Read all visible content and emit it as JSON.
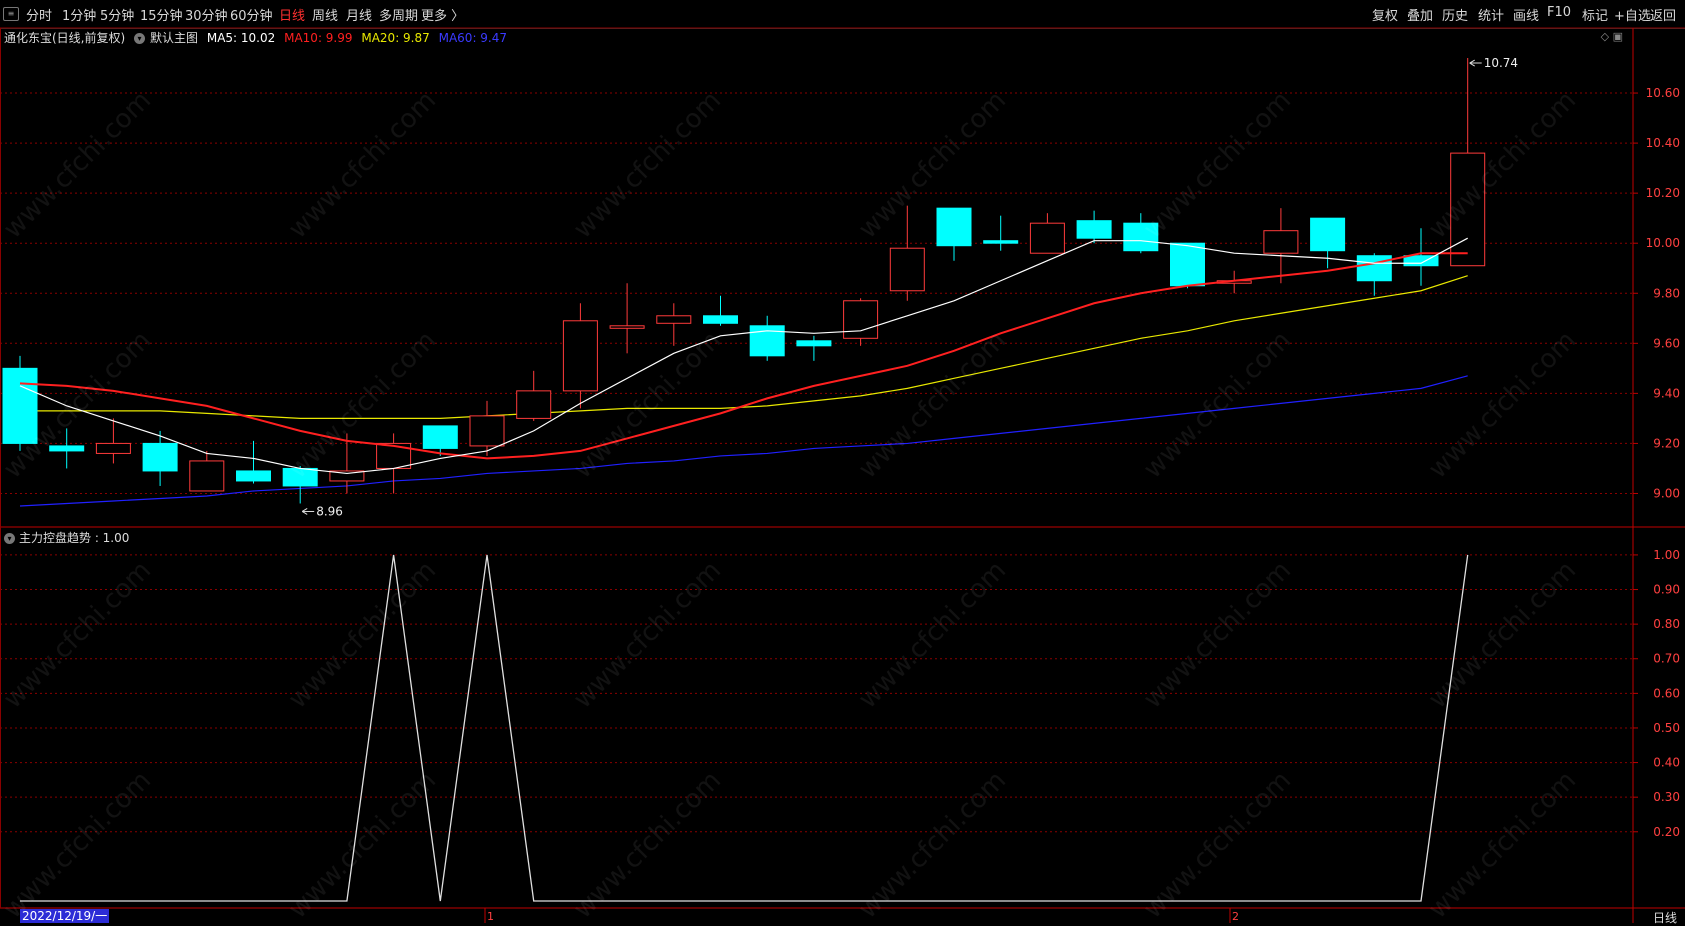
{
  "toolbar": {
    "periods": [
      "分时",
      "1分钟",
      "5分钟",
      "15分钟",
      "30分钟",
      "60分钟",
      "日线",
      "周线",
      "月线",
      "多周期",
      "更多 〉"
    ],
    "active_period": "日线",
    "right_items": [
      "复权",
      "叠加",
      "历史",
      "统计",
      "画线",
      "F10",
      "标记",
      "+自选",
      "返回"
    ]
  },
  "info": {
    "stock": "通化东宝(日线,前复权)",
    "main_label": "默认主图",
    "ma5": "MA5: 10.02",
    "ma10": "MA10: 9.99",
    "ma20": "MA20: 9.87",
    "ma60": "MA60: 9.47"
  },
  "sub_indicator": "主力控盘趋势 : 1.00",
  "bottom": {
    "date": "2022/12/19/一",
    "period": "日线",
    "markers": [
      "1",
      "2"
    ]
  },
  "watermark": "www.cfchi.com",
  "colors": {
    "up": "#ff3b3b",
    "down": "#00ffff",
    "ma5": "#ffffff",
    "ma10": "#ff2020",
    "ma20": "#e8e800",
    "ma60": "#2020ff",
    "grid": "#8a0000",
    "active": "#ff3030"
  },
  "chart_data": [
    {
      "type": "candlestick",
      "title": "通化东宝(日线,前复权)",
      "yticks": [
        "9.00",
        "9.20",
        "9.40",
        "9.60",
        "9.80",
        "10.00",
        "10.20",
        "10.40",
        "10.60"
      ],
      "ylim": [
        8.87,
        10.78
      ],
      "candles": [
        {
          "o": 9.5,
          "h": 9.55,
          "l": 9.17,
          "c": 9.2
        },
        {
          "o": 9.19,
          "h": 9.26,
          "l": 9.1,
          "c": 9.17
        },
        {
          "o": 9.16,
          "h": 9.3,
          "l": 9.12,
          "c": 9.2
        },
        {
          "o": 9.2,
          "h": 9.25,
          "l": 9.03,
          "c": 9.09
        },
        {
          "o": 9.01,
          "h": 9.17,
          "l": 9.01,
          "c": 9.13
        },
        {
          "o": 9.09,
          "h": 9.21,
          "l": 9.04,
          "c": 9.05
        },
        {
          "o": 9.1,
          "h": 9.11,
          "l": 8.96,
          "c": 9.03
        },
        {
          "o": 9.05,
          "h": 9.24,
          "l": 9.0,
          "c": 9.09
        },
        {
          "o": 9.1,
          "h": 9.24,
          "l": 9.0,
          "c": 9.2
        },
        {
          "o": 9.27,
          "h": 9.27,
          "l": 9.15,
          "c": 9.18
        },
        {
          "o": 9.19,
          "h": 9.37,
          "l": 9.15,
          "c": 9.31
        },
        {
          "o": 9.3,
          "h": 9.49,
          "l": 9.29,
          "c": 9.41
        },
        {
          "o": 9.41,
          "h": 9.76,
          "l": 9.34,
          "c": 9.69
        },
        {
          "o": 9.66,
          "h": 9.84,
          "l": 9.56,
          "c": 9.67
        },
        {
          "o": 9.68,
          "h": 9.76,
          "l": 9.59,
          "c": 9.71
        },
        {
          "o": 9.71,
          "h": 9.79,
          "l": 9.67,
          "c": 9.68
        },
        {
          "o": 9.67,
          "h": 9.71,
          "l": 9.53,
          "c": 9.55
        },
        {
          "o": 9.61,
          "h": 9.63,
          "l": 9.53,
          "c": 9.59
        },
        {
          "o": 9.62,
          "h": 9.78,
          "l": 9.59,
          "c": 9.77
        },
        {
          "o": 9.81,
          "h": 10.15,
          "l": 9.77,
          "c": 9.98
        },
        {
          "o": 10.14,
          "h": 10.14,
          "l": 9.93,
          "c": 9.99
        },
        {
          "o": 10.01,
          "h": 10.11,
          "l": 9.97,
          "c": 10.0
        },
        {
          "o": 9.96,
          "h": 10.12,
          "l": 9.96,
          "c": 10.08
        },
        {
          "o": 10.09,
          "h": 10.13,
          "l": 10.0,
          "c": 10.02
        },
        {
          "o": 10.08,
          "h": 10.12,
          "l": 9.96,
          "c": 9.97
        },
        {
          "o": 10.0,
          "h": 10.0,
          "l": 9.82,
          "c": 9.83
        },
        {
          "o": 9.84,
          "h": 9.89,
          "l": 9.8,
          "c": 9.85
        },
        {
          "o": 9.96,
          "h": 10.14,
          "l": 9.84,
          "c": 10.05
        },
        {
          "o": 10.1,
          "h": 10.1,
          "l": 9.9,
          "c": 9.97
        },
        {
          "o": 9.95,
          "h": 9.96,
          "l": 9.79,
          "c": 9.85
        },
        {
          "o": 9.95,
          "h": 10.06,
          "l": 9.83,
          "c": 9.91
        },
        {
          "o": 9.91,
          "h": 10.74,
          "l": 9.91,
          "c": 10.36
        }
      ],
      "ma5": [
        9.43,
        9.35,
        9.29,
        9.23,
        9.16,
        9.14,
        9.1,
        9.08,
        9.1,
        9.14,
        9.17,
        9.25,
        9.36,
        9.46,
        9.56,
        9.63,
        9.65,
        9.64,
        9.65,
        9.71,
        9.77,
        9.85,
        9.93,
        10.01,
        10.01,
        9.99,
        9.96,
        9.95,
        9.94,
        9.92,
        9.92,
        10.02
      ],
      "ma10": [
        9.44,
        9.43,
        9.41,
        9.38,
        9.35,
        9.3,
        9.25,
        9.21,
        9.19,
        9.16,
        9.14,
        9.15,
        9.17,
        9.22,
        9.27,
        9.32,
        9.38,
        9.43,
        9.47,
        9.51,
        9.57,
        9.64,
        9.7,
        9.76,
        9.8,
        9.83,
        9.85,
        9.87,
        9.89,
        9.92,
        9.96,
        9.96,
        9.99
      ],
      "ma20": [
        9.33,
        9.33,
        9.33,
        9.33,
        9.32,
        9.31,
        9.3,
        9.3,
        9.3,
        9.3,
        9.31,
        9.32,
        9.33,
        9.34,
        9.34,
        9.34,
        9.35,
        9.37,
        9.39,
        9.42,
        9.46,
        9.5,
        9.54,
        9.58,
        9.62,
        9.65,
        9.69,
        9.72,
        9.75,
        9.78,
        9.81,
        9.87
      ],
      "ma60": [
        8.95,
        8.96,
        8.97,
        8.98,
        8.99,
        9.01,
        9.02,
        9.03,
        9.05,
        9.06,
        9.08,
        9.09,
        9.1,
        9.12,
        9.13,
        9.15,
        9.16,
        9.18,
        9.19,
        9.2,
        9.22,
        9.24,
        9.26,
        9.28,
        9.3,
        9.32,
        9.34,
        9.36,
        9.38,
        9.4,
        9.42,
        9.47
      ],
      "annotations": [
        {
          "label": "8.96",
          "index": 6,
          "value": 8.96
        },
        {
          "label": "10.74",
          "index": 31,
          "value": 10.74
        }
      ]
    },
    {
      "type": "line",
      "title": "主力控盘趋势",
      "yticks": [
        "0.20",
        "0.30",
        "0.40",
        "0.50",
        "0.60",
        "0.70",
        "0.80",
        "0.90",
        "1.00"
      ],
      "ylim": [
        0.0,
        1.02
      ],
      "x": [
        0,
        1,
        2,
        3,
        4,
        5,
        6,
        7,
        8,
        9,
        10,
        11,
        12,
        13,
        14,
        15,
        16,
        17,
        18,
        19,
        20,
        21,
        22,
        23,
        24,
        25,
        26,
        27,
        28,
        29,
        30,
        31
      ],
      "values": [
        0,
        0,
        0,
        0,
        0,
        0,
        0,
        0,
        1,
        0,
        1,
        0,
        0,
        0,
        0,
        0,
        0,
        0,
        0,
        0,
        0,
        0,
        0,
        0,
        0,
        0,
        0,
        0,
        0,
        0,
        0,
        1
      ]
    }
  ]
}
